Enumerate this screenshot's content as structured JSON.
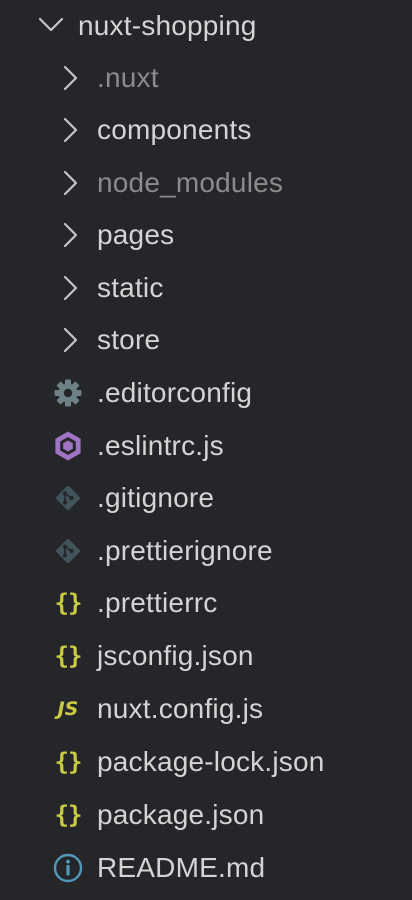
{
  "explorer": {
    "root": {
      "label": "nuxt-shopping",
      "icon": "chevron-down-icon",
      "expanded": true
    },
    "folders": [
      {
        "label": ".nuxt",
        "icon": "chevron-right-icon",
        "dimmed": true
      },
      {
        "label": "components",
        "icon": "chevron-right-icon",
        "dimmed": false
      },
      {
        "label": "node_modules",
        "icon": "chevron-right-icon",
        "dimmed": true
      },
      {
        "label": "pages",
        "icon": "chevron-right-icon",
        "dimmed": false
      },
      {
        "label": "static",
        "icon": "chevron-right-icon",
        "dimmed": false
      },
      {
        "label": "store",
        "icon": "chevron-right-icon",
        "dimmed": false
      }
    ],
    "files": [
      {
        "label": ".editorconfig",
        "icon": "gear-icon"
      },
      {
        "label": ".eslintrc.js",
        "icon": "eslint-icon"
      },
      {
        "label": ".gitignore",
        "icon": "git-icon"
      },
      {
        "label": ".prettierignore",
        "icon": "git-icon"
      },
      {
        "label": ".prettierrc",
        "icon": "json-braces-icon",
        "glyph": "{}"
      },
      {
        "label": "jsconfig.json",
        "icon": "json-braces-icon",
        "glyph": "{}"
      },
      {
        "label": "nuxt.config.js",
        "icon": "javascript-icon",
        "glyph": "JS"
      },
      {
        "label": "package-lock.json",
        "icon": "json-braces-icon",
        "glyph": "{}"
      },
      {
        "label": "package.json",
        "icon": "json-braces-icon",
        "glyph": "{}"
      },
      {
        "label": "README.md",
        "icon": "info-icon"
      }
    ]
  },
  "colors": {
    "background": "#25262a",
    "text": "#d4d4d4",
    "dimmed_text": "#8b8b8b",
    "chevron": "#c5c5c5",
    "json_yellow": "#cbcb41",
    "eslint_purple": "#a074c4",
    "gear_grey": "#6d8086",
    "git_grey": "#41535b",
    "info_blue": "#519aba"
  }
}
